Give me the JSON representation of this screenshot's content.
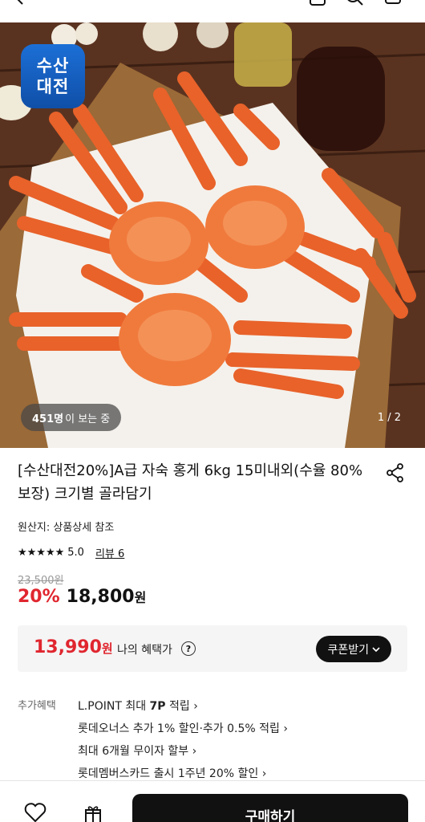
{
  "brand": {
    "logo_line1": "수산",
    "logo_line2": "대전"
  },
  "gallery": {
    "viewers_count": "451명",
    "viewers_suffix": "이 보는 중",
    "pager": "1 / 2"
  },
  "product": {
    "title": "[수산대전20%]A급 자숙 홍게 6kg 15미내외(수율 80% 보장) 크기별 골라담기",
    "origin": "원산지: 상품상세 참조",
    "stars": "★★★★★",
    "score": "5.0",
    "review_link": "리뷰 6",
    "original_price": "23,500원",
    "discount": "20%",
    "sale_price": "18,800",
    "sale_unit": "원"
  },
  "benefit": {
    "price": "13,990",
    "price_unit": "원",
    "label": "나의 혜택가",
    "help_icon": "?",
    "coupon_button": "쿠폰받기"
  },
  "extra": {
    "label": "추가혜택",
    "items": [
      {
        "pre": "L.POINT 최대 ",
        "bold": "7P",
        "post": " 적립 ›"
      },
      {
        "pre": "롯데오너스 추가 1% 할인·추가 0.5% 적립 ›",
        "bold": "",
        "post": ""
      },
      {
        "pre": "최대 6개월 무이자 할부 ›",
        "bold": "",
        "post": ""
      },
      {
        "pre": "롯데멤버스카드 출시 1주년 20% 할인 ›",
        "bold": "",
        "post": ""
      }
    ]
  },
  "bottom": {
    "buy_label": "구매하기"
  },
  "icons": [
    "back-icon",
    "cart-icon",
    "search-icon",
    "bag-icon",
    "share-icon",
    "heart-icon",
    "gift-icon",
    "help-icon",
    "chevron-down-icon"
  ],
  "colors": {
    "accent_red": "#e0262f",
    "dark": "#111111",
    "logo_blue": "#1c6fd6"
  }
}
